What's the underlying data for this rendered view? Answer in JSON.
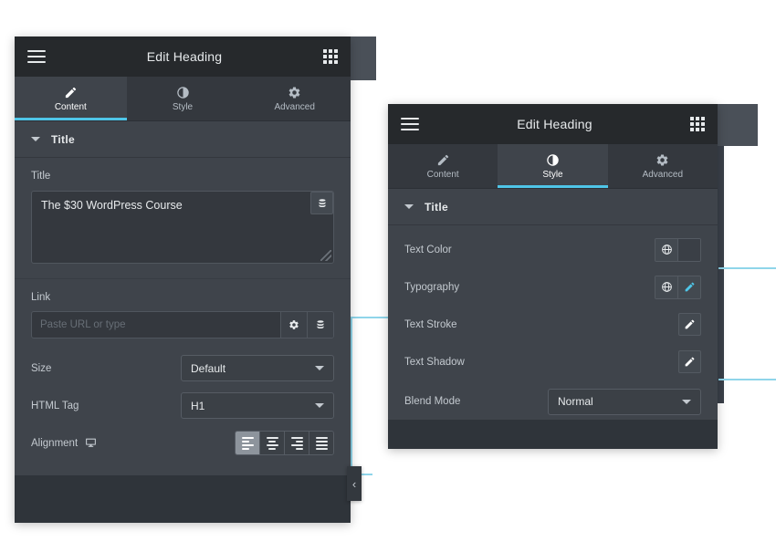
{
  "panel_content": {
    "header": {
      "title": "Edit Heading",
      "menu_icon": "hamburger-icon",
      "grid_icon": "grid-icon"
    },
    "tabs": [
      {
        "label": "Content",
        "icon": "pencil-icon",
        "active": true
      },
      {
        "label": "Style",
        "icon": "contrast-circle-icon",
        "active": false
      },
      {
        "label": "Advanced",
        "icon": "gear-icon",
        "active": false
      }
    ],
    "section": {
      "label": "Title",
      "caret": "chevron-down-icon"
    },
    "title_field": {
      "label": "Title",
      "value": "The $30 WordPress Course",
      "dynamic_tag_icon": "database-icon"
    },
    "link_field": {
      "label": "Link",
      "value": "",
      "placeholder": "Paste URL or type",
      "options_icon": "gear-icon",
      "dynamic_tag_icon": "database-icon"
    },
    "size_field": {
      "label": "Size",
      "value": "Default",
      "caret": "chevron-down-icon"
    },
    "html_tag_field": {
      "label": "HTML Tag",
      "value": "H1",
      "caret": "chevron-down-icon"
    },
    "alignment_field": {
      "label": "Alignment",
      "device_icon": "desktop-icon",
      "options": [
        {
          "name": "align-left",
          "active": true
        },
        {
          "name": "align-center",
          "active": false
        },
        {
          "name": "align-right",
          "active": false
        },
        {
          "name": "align-justify",
          "active": false
        }
      ]
    },
    "collapse_toggle": {
      "icon": "chevron-left-icon"
    }
  },
  "panel_style": {
    "header": {
      "title": "Edit Heading",
      "menu_icon": "hamburger-icon",
      "grid_icon": "grid-icon"
    },
    "tabs": [
      {
        "label": "Content",
        "icon": "pencil-icon",
        "active": false
      },
      {
        "label": "Style",
        "icon": "contrast-circle-icon",
        "active": true
      },
      {
        "label": "Advanced",
        "icon": "gear-icon",
        "active": false
      }
    ],
    "section": {
      "label": "Title",
      "caret": "chevron-down-icon"
    },
    "rows": [
      {
        "label": "Text Color",
        "globe_icon": "globe-icon",
        "control": "color-swatch",
        "swatch_color": "#3a3f46"
      },
      {
        "label": "Typography",
        "globe_icon": "globe-icon",
        "control": "edit-pencil",
        "pencil_accent": "#4fc6e8"
      },
      {
        "label": "Text Stroke",
        "control": "edit-pencil",
        "pencil_accent": "#ffffff"
      },
      {
        "label": "Text Shadow",
        "control": "edit-pencil",
        "pencil_accent": "#ffffff"
      }
    ],
    "blend_mode_field": {
      "label": "Blend Mode",
      "value": "Normal",
      "caret": "chevron-down-icon"
    }
  },
  "colors": {
    "accent_cyan": "#4fc6e8",
    "connector_cyan": "#8fd5ea",
    "panel_bg": "#3f444b",
    "header_bg": "#26292c",
    "tabbar_bg": "#34383e"
  }
}
